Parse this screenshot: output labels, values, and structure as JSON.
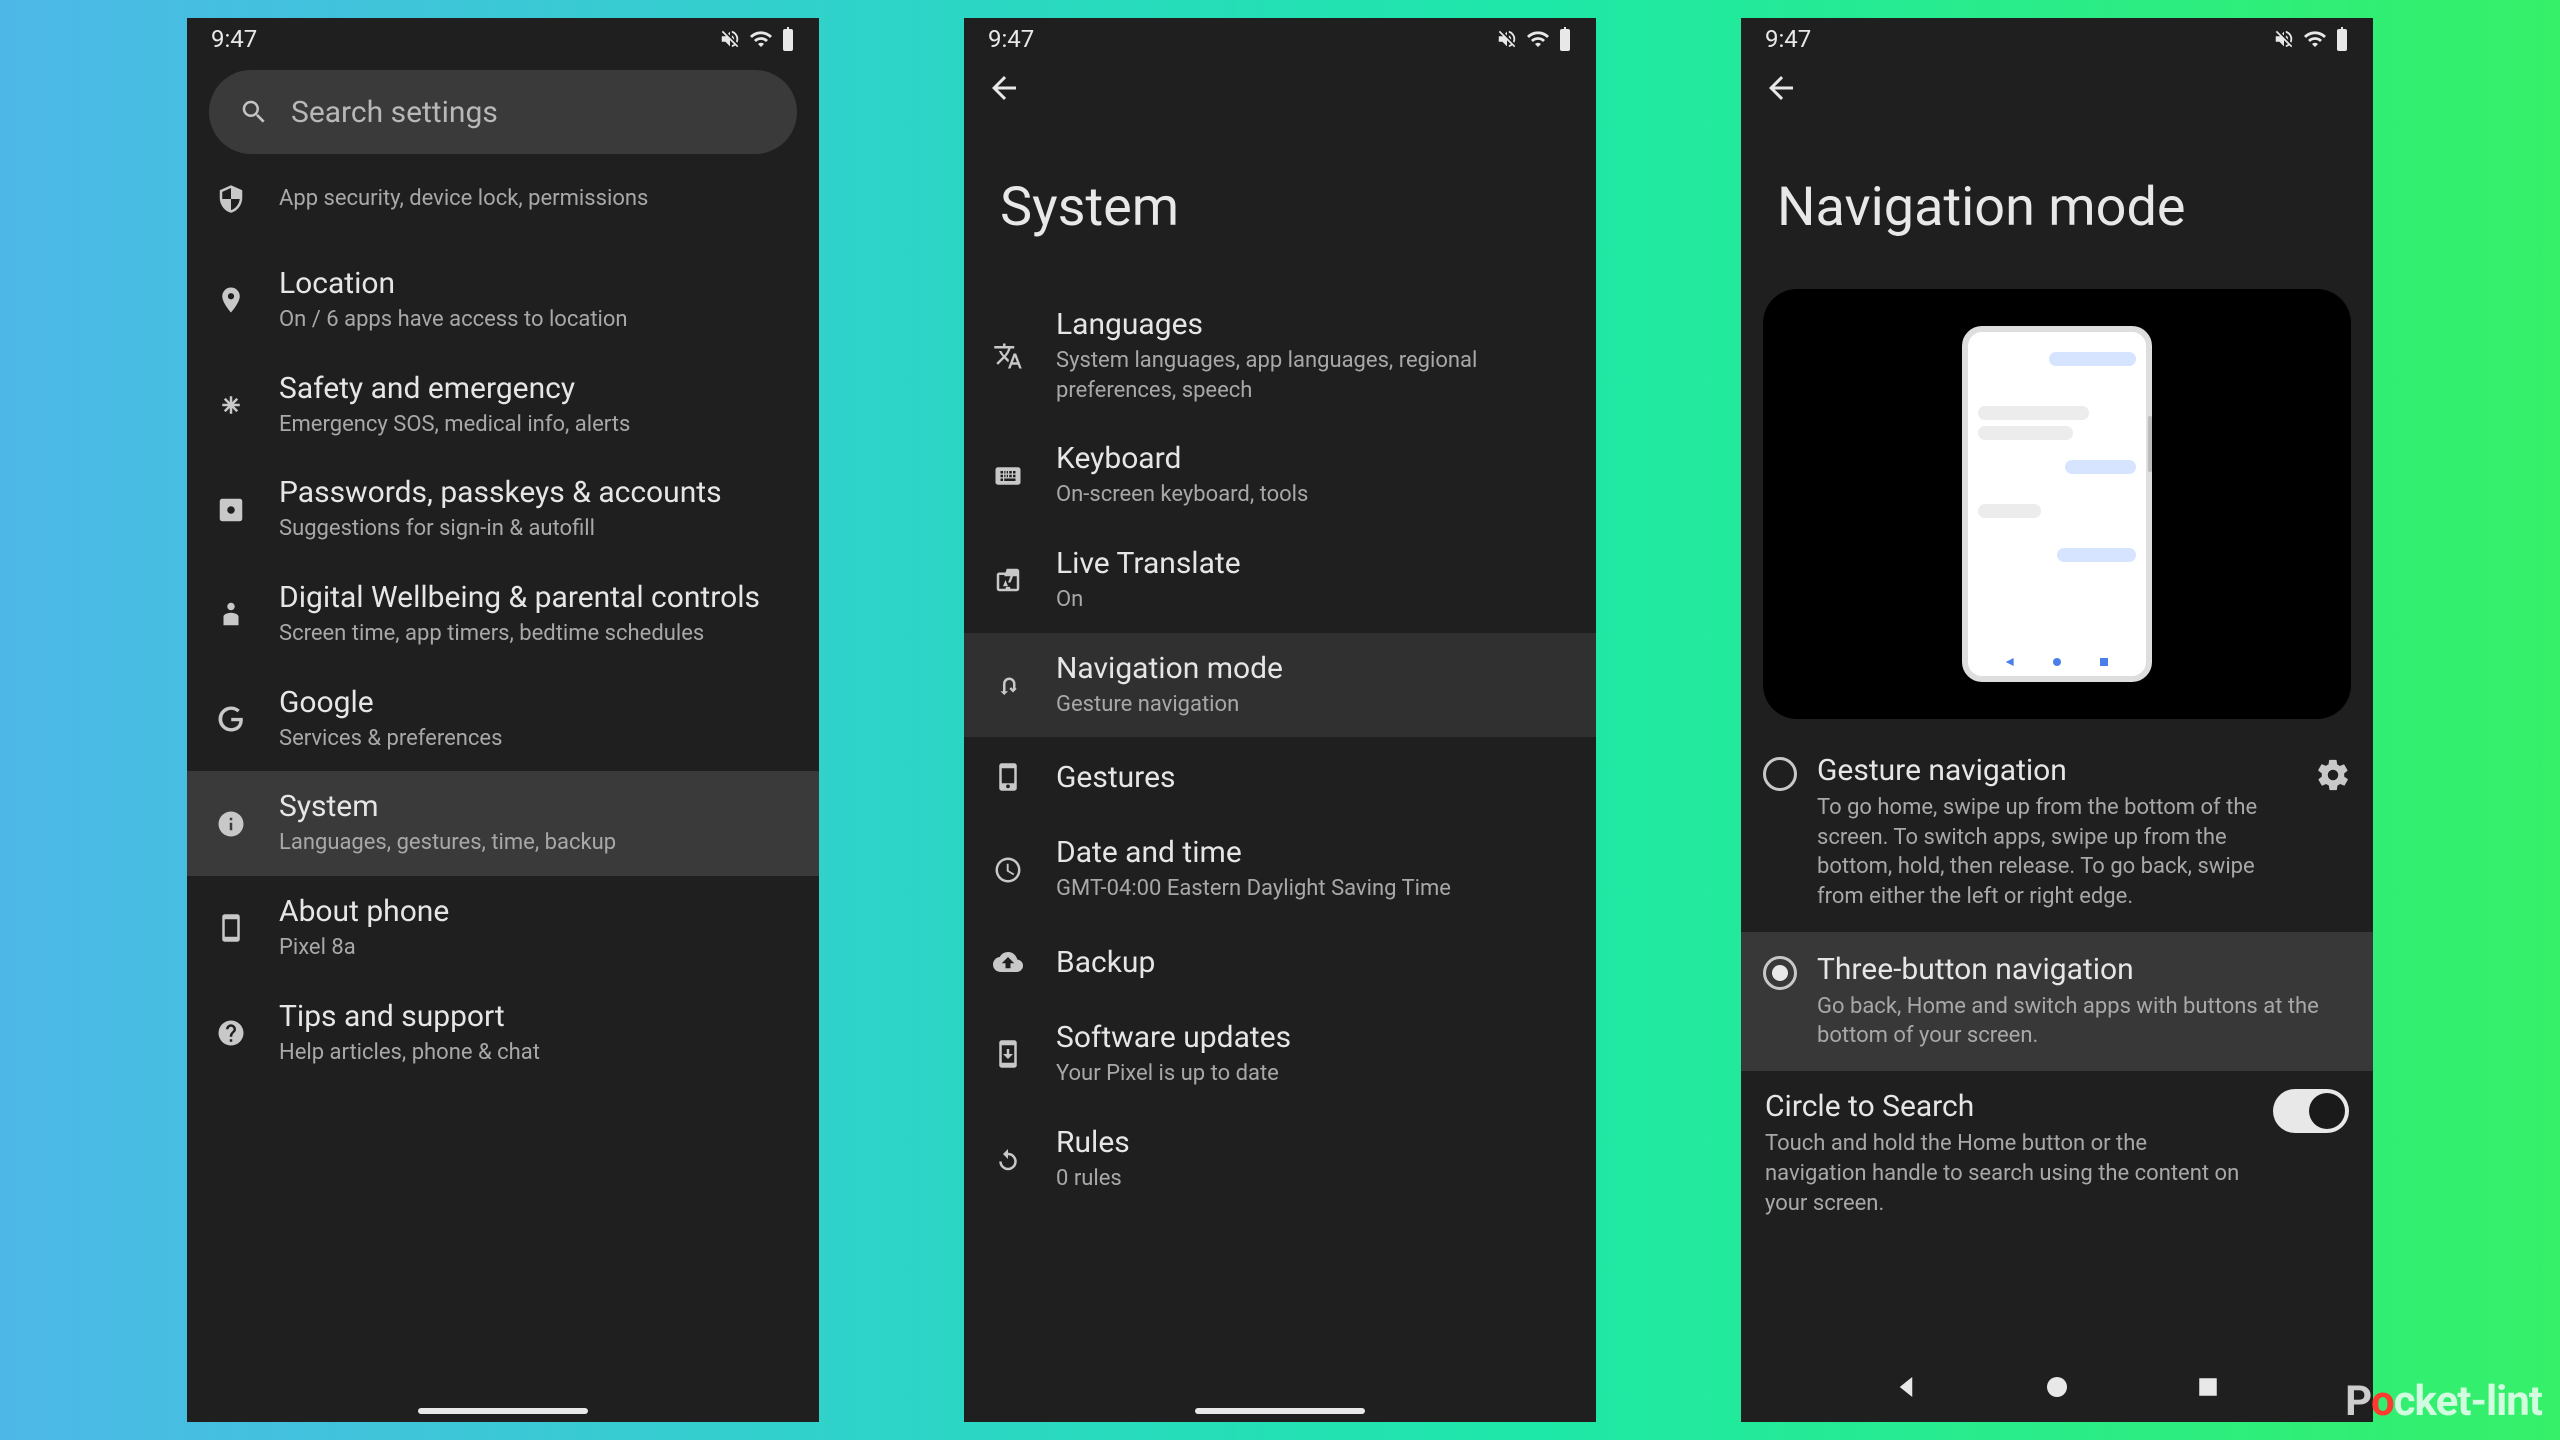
{
  "status": {
    "time": "9:47"
  },
  "screen1": {
    "search_placeholder": "Search settings",
    "items": [
      {
        "icon": "shield",
        "title": "",
        "sub": "App security, device lock, permissions",
        "partial": true
      },
      {
        "icon": "location",
        "title": "Location",
        "sub": "On / 6 apps have access to location"
      },
      {
        "icon": "asterisk",
        "title": "Safety and emergency",
        "sub": "Emergency SOS, medical info, alerts"
      },
      {
        "icon": "key",
        "title": "Passwords, passkeys & accounts",
        "sub": "Suggestions for sign-in & autofill"
      },
      {
        "icon": "wellbeing",
        "title": "Digital Wellbeing & parental controls",
        "sub": "Screen time, app timers, bedtime schedules"
      },
      {
        "icon": "google",
        "title": "Google",
        "sub": "Services & preferences"
      },
      {
        "icon": "info",
        "title": "System",
        "sub": "Languages, gestures, time, backup",
        "highlighted": true
      },
      {
        "icon": "phone",
        "title": "About phone",
        "sub": "Pixel 8a"
      },
      {
        "icon": "help",
        "title": "Tips and support",
        "sub": "Help articles, phone & chat"
      }
    ]
  },
  "screen2": {
    "title": "System",
    "items": [
      {
        "icon": "language",
        "title": "Languages",
        "sub": "System languages, app languages, regional preferences, speech"
      },
      {
        "icon": "keyboard",
        "title": "Keyboard",
        "sub": "On-screen keyboard, tools"
      },
      {
        "icon": "translate",
        "title": "Live Translate",
        "sub": "On"
      },
      {
        "icon": "swipe",
        "title": "Navigation mode",
        "sub": "Gesture navigation",
        "highlighted": true
      },
      {
        "icon": "gesture",
        "title": "Gestures",
        "sub": ""
      },
      {
        "icon": "clock",
        "title": "Date and time",
        "sub": "GMT-04:00 Eastern Daylight Saving Time"
      },
      {
        "icon": "backup",
        "title": "Backup",
        "sub": ""
      },
      {
        "icon": "update",
        "title": "Software updates",
        "sub": "Your Pixel is up to date"
      },
      {
        "icon": "rules",
        "title": "Rules",
        "sub": "0 rules",
        "partial_bottom": true
      }
    ]
  },
  "screen3": {
    "title": "Navigation mode",
    "options": [
      {
        "title": "Gesture navigation",
        "desc": "To go home, swipe up from the bot­tom of the screen. To switch apps, swipe up from the bottom, hold, then release. To go back, swipe from either the left or right edge.",
        "selected": false,
        "gear": true
      },
      {
        "title": "Three-button navigation",
        "desc": "Go back, Home and switch apps with buttons at the bottom of your screen.",
        "selected": true,
        "gear": false
      }
    ],
    "cts": {
      "title": "Circle to Search",
      "desc": "Touch and hold the Home button or the navigation handle to search using the content on your screen."
    }
  },
  "watermark": {
    "pre": "P",
    "o": "o",
    "post": "cket-lint"
  }
}
